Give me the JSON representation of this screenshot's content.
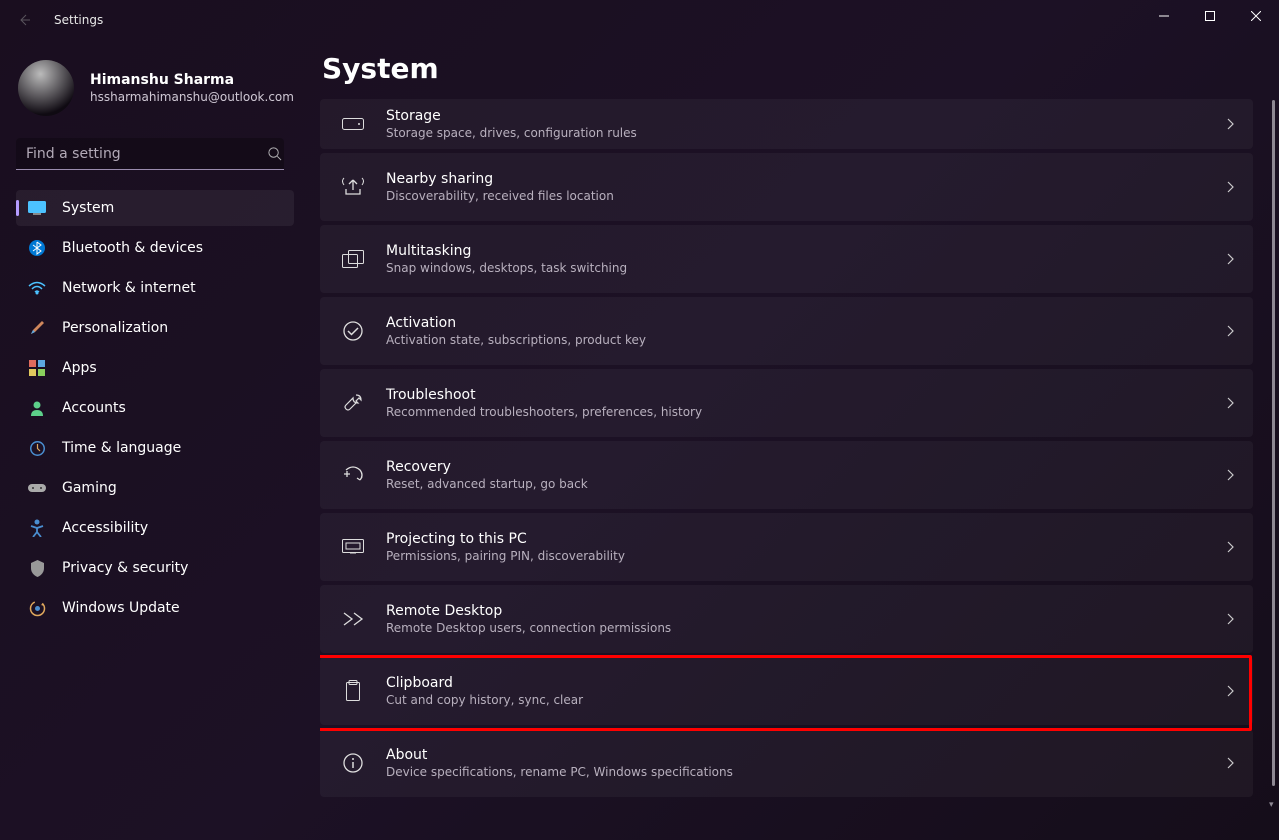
{
  "window": {
    "title": "Settings"
  },
  "profile": {
    "name": "Himanshu Sharma",
    "email": "hssharmahimanshu@outlook.com"
  },
  "search": {
    "placeholder": "Find a setting"
  },
  "nav": {
    "items": [
      {
        "label": "System"
      },
      {
        "label": "Bluetooth & devices"
      },
      {
        "label": "Network & internet"
      },
      {
        "label": "Personalization"
      },
      {
        "label": "Apps"
      },
      {
        "label": "Accounts"
      },
      {
        "label": "Time & language"
      },
      {
        "label": "Gaming"
      },
      {
        "label": "Accessibility"
      },
      {
        "label": "Privacy & security"
      },
      {
        "label": "Windows Update"
      }
    ]
  },
  "page": {
    "title": "System"
  },
  "cards": [
    {
      "title": "Storage",
      "sub": "Storage space, drives, configuration rules"
    },
    {
      "title": "Nearby sharing",
      "sub": "Discoverability, received files location"
    },
    {
      "title": "Multitasking",
      "sub": "Snap windows, desktops, task switching"
    },
    {
      "title": "Activation",
      "sub": "Activation state, subscriptions, product key"
    },
    {
      "title": "Troubleshoot",
      "sub": "Recommended troubleshooters, preferences, history"
    },
    {
      "title": "Recovery",
      "sub": "Reset, advanced startup, go back"
    },
    {
      "title": "Projecting to this PC",
      "sub": "Permissions, pairing PIN, discoverability"
    },
    {
      "title": "Remote Desktop",
      "sub": "Remote Desktop users, connection permissions"
    },
    {
      "title": "Clipboard",
      "sub": "Cut and copy history, sync, clear"
    },
    {
      "title": "About",
      "sub": "Device specifications, rename PC, Windows specifications"
    }
  ]
}
